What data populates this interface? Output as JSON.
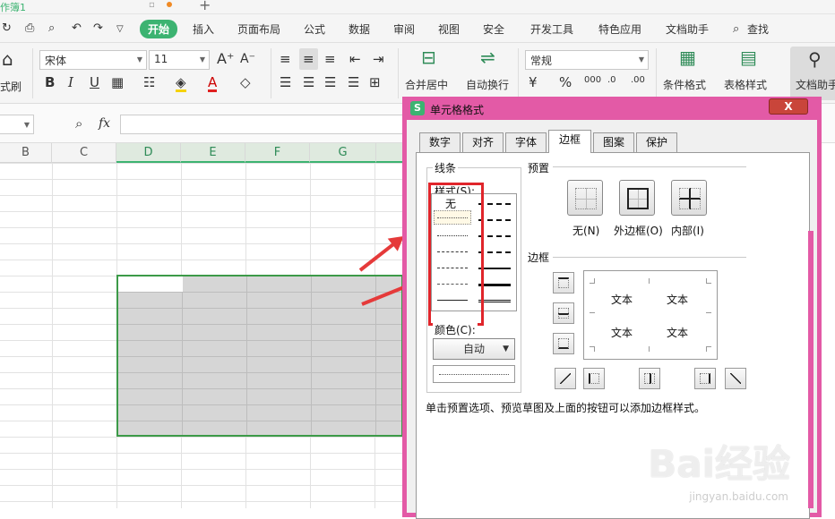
{
  "window": {
    "tab_label": "作簿1"
  },
  "ribbon": {
    "tabs": [
      {
        "label": "开始",
        "active": true
      },
      {
        "label": "插入"
      },
      {
        "label": "页面布局"
      },
      {
        "label": "公式"
      },
      {
        "label": "数据"
      },
      {
        "label": "审阅"
      },
      {
        "label": "视图"
      },
      {
        "label": "安全"
      },
      {
        "label": "开发工具"
      },
      {
        "label": "特色应用"
      },
      {
        "label": "文档助手"
      },
      {
        "label": "查找"
      }
    ]
  },
  "toolbar": {
    "format_painter": "式刷",
    "font_name": "宋体",
    "font_size": "11",
    "number_format": "常规",
    "merge_center": "合并居中",
    "wrap_text": "自动换行",
    "conditional_format": "条件格式",
    "table_style": "表格样式",
    "doc_helper": "文档助手",
    "fx": "fx"
  },
  "columns": [
    "B",
    "C",
    "D",
    "E",
    "F",
    "G"
  ],
  "dialog": {
    "title": "单元格格式",
    "close": "X",
    "tabs": [
      "数字",
      "对齐",
      "字体",
      "边框",
      "图案",
      "保护"
    ],
    "active_tab": "边框",
    "line_group": "线条",
    "style_label": "样式(S):",
    "style_none": "无",
    "color_label": "颜色(C):",
    "color_value": "自动",
    "preset_group": "预置",
    "presets": [
      "无(N)",
      "外边框(O)",
      "内部(I)"
    ],
    "border_group": "边框",
    "preview_text": [
      "文本",
      "文本",
      "文本",
      "文本"
    ],
    "hint": "单击预置选项、预览草图及上面的按钮可以添加边框样式。"
  },
  "watermark": {
    "logo": "Bai经验",
    "url": "jingyan.baidu.com"
  },
  "colors": {
    "accent": "#3cb371",
    "dialog_border": "#e35aa6",
    "highlight": "#e0252b",
    "selection": "#d6d6d6"
  }
}
